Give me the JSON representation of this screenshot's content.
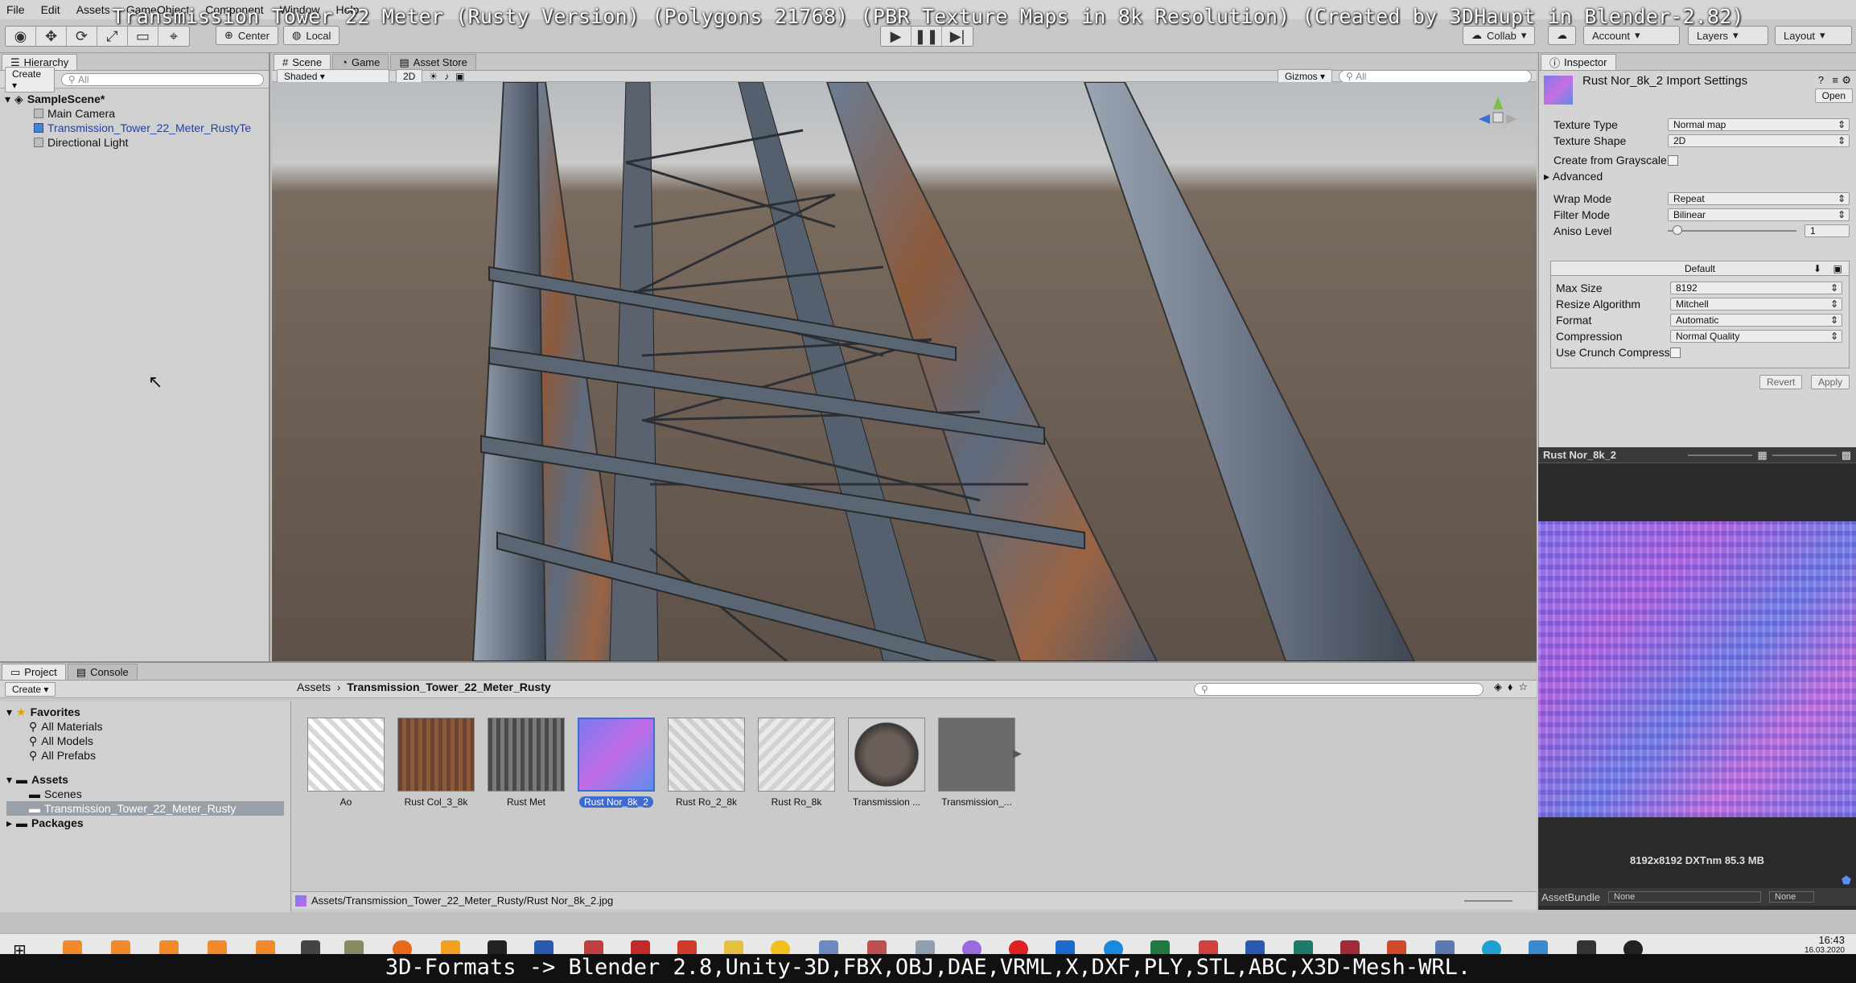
{
  "menu": [
    "File",
    "Edit",
    "Assets",
    "GameObject",
    "Component",
    "Window",
    "Help"
  ],
  "toolbar": {
    "pivot": "Center",
    "space": "Local",
    "collab": "Collab",
    "account": "Account",
    "layers": "Layers",
    "layout": "Layout"
  },
  "video_title": "Transmission Tower 22 Meter (Rusty Version) (Polygons 21768) (PBR Texture Maps in 8k Resolution) (Created by 3DHaupt in Blender-2.82)",
  "video_footer": "3D-Formats -> Blender 2.8,Unity-3D,FBX,OBJ,DAE,VRML,X,DXF,PLY,STL,ABC,X3D-Mesh-WRL.",
  "hierarchy": {
    "tab": "Hierarchy",
    "create": "Create",
    "search_placeholder": "All",
    "scene": "SampleScene*",
    "items": [
      "Main Camera",
      "Transmission_Tower_22_Meter_RustyTe",
      "Directional Light"
    ]
  },
  "scene": {
    "tabs": [
      "Scene",
      "Game",
      "Asset Store"
    ],
    "shading": "Shaded",
    "mode2d": "2D",
    "gizmos": "Gizmos",
    "search_placeholder": "All"
  },
  "inspector": {
    "tab": "Inspector",
    "title": "Rust Nor_8k_2 Import Settings",
    "open": "Open",
    "rows": [
      {
        "label": "Texture Type",
        "value": "Normal map"
      },
      {
        "label": "Texture Shape",
        "value": "2D"
      }
    ],
    "create_from_grayscale": "Create from Grayscale",
    "advanced": "Advanced",
    "wrap": {
      "label": "Wrap Mode",
      "value": "Repeat"
    },
    "filter": {
      "label": "Filter Mode",
      "value": "Bilinear"
    },
    "aniso": {
      "label": "Aniso Level",
      "value": "1"
    },
    "platform": {
      "header": "Default",
      "rows": [
        {
          "label": "Max Size",
          "value": "8192"
        },
        {
          "label": "Resize Algorithm",
          "value": "Mitchell"
        },
        {
          "label": "Format",
          "value": "Automatic"
        },
        {
          "label": "Compression",
          "value": "Normal Quality"
        }
      ],
      "crunch": "Use Crunch Compression"
    },
    "revert": "Revert",
    "apply": "Apply"
  },
  "preview": {
    "title": "Rust Nor_8k_2",
    "info": "8192x8192  DXTnm  85.3 MB",
    "assetbundle": "AssetBundle",
    "bundle_value": "None",
    "variant_value": "None"
  },
  "project": {
    "tabs": [
      "Project",
      "Console"
    ],
    "create": "Create",
    "favorites": "Favorites",
    "fav_items": [
      "All Materials",
      "All Models",
      "All Prefabs"
    ],
    "assets": "Assets",
    "asset_items": [
      "Scenes",
      "Transmission_Tower_22_Meter_Rusty"
    ],
    "packages": "Packages",
    "breadcrumb": [
      "Assets",
      "Transmission_Tower_22_Meter_Rusty"
    ],
    "files": [
      {
        "label": "Ao"
      },
      {
        "label": "Rust Col_3_8k"
      },
      {
        "label": "Rust Met"
      },
      {
        "label": "Rust Nor_8k_2"
      },
      {
        "label": "Rust Ro_2_8k"
      },
      {
        "label": "Rust Ro_8k"
      },
      {
        "label": "Transmission ..."
      },
      {
        "label": "Transmission_..."
      }
    ],
    "selected_index": 3,
    "path": "Assets/Transmission_Tower_22_Meter_Rusty/Rust Nor_8k_2.jpg"
  },
  "clock": {
    "time": "16:43",
    "date": "16.03.2020"
  },
  "colors": {
    "selection": "#3d6bd0",
    "panel": "#d0d0d0"
  }
}
